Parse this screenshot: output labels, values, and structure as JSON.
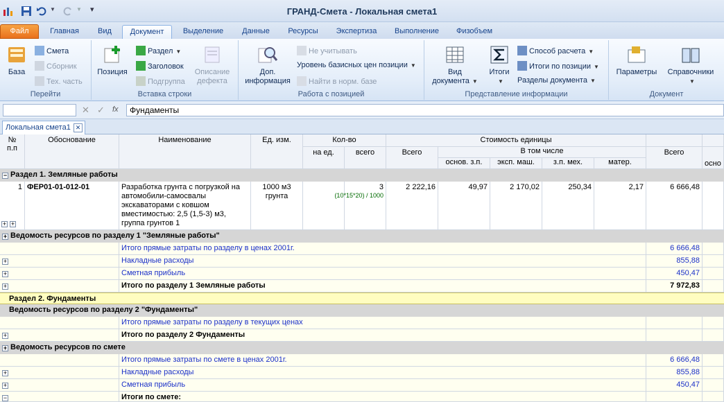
{
  "window": {
    "title": "ГРАНД-Смета - Локальная смета1"
  },
  "tabs": [
    "Файл",
    "Главная",
    "Вид",
    "Документ",
    "Выделение",
    "Данные",
    "Ресурсы",
    "Экспертиза",
    "Выполнение",
    "Физобъем"
  ],
  "ribbon": {
    "goto": {
      "label": "Перейти",
      "base": "База",
      "smeta": "Смета",
      "sbornik": "Сборник",
      "tech": "Тех. часть"
    },
    "insert": {
      "label": "Вставка строки",
      "position": "Позиция",
      "razdel": "Раздел",
      "zagolovok": "Заголовок",
      "podgruppa": "Подгруппа",
      "opisanie1": "Описание",
      "opisanie2": "дефекта"
    },
    "work": {
      "label": "Работа с позицией",
      "dop1": "Доп.",
      "dop2": "информация",
      "ne_uchit": "Не учитывать",
      "uroven": "Уровень базисных цен позиции",
      "najti": "Найти в норм. базе"
    },
    "present": {
      "label": "Представление информации",
      "vid1": "Вид",
      "vid2": "документа",
      "itogi": "Итоги",
      "sposob": "Способ расчета",
      "itogi_poz": "Итоги по позиции",
      "razdely": "Разделы документа"
    },
    "doc": {
      "label": "Документ",
      "params": "Параметры",
      "sprav": "Справочники"
    }
  },
  "formula": {
    "value": "Фундаменты"
  },
  "doc_tab": "Локальная смета1",
  "header": {
    "num": "№ п.п",
    "obosn": "Обоснование",
    "name": "Наименование",
    "unit": "Ед. изм.",
    "qty": "Кол-во",
    "qty_per": "на ед.",
    "qty_total": "всего",
    "unit_cost": "Стоимость единицы",
    "uc_total": "Всего",
    "incl": "В том числе",
    "osn": "основ. з.п.",
    "eksp": "эксп. маш.",
    "zpmeh": "з.п. мех.",
    "mater": "матер.",
    "total": "Всего",
    "osno": "осно"
  },
  "rows": {
    "sec1": "Раздел 1. Земляные работы",
    "pos": {
      "num": "1",
      "code": "ФЕР01-01-012-01",
      "name": "Разработка грунта с погрузкой на автомобили-самосвалы экскаваторами с ковшом вместимостью: 2,5 (1,5-3) м3, группа грунтов 1",
      "unit": "1000 м3 грунта",
      "qty_total": "3",
      "formula": "(10*15*20) / 1000",
      "uc_total": "2 222,16",
      "osn": "49,97",
      "eksp": "2 170,02",
      "zpmeh": "250,34",
      "mater": "2,17",
      "total": "6 666,48"
    },
    "ved1": "Ведомость ресурсов по разделу 1 \"Земляные работы\"",
    "s1_direct": {
      "label": "Итого прямые затраты по разделу в ценах 2001г.",
      "value": "6 666,48"
    },
    "s1_nakl": {
      "label": "Накладные расходы",
      "value": "855,88"
    },
    "s1_prib": {
      "label": "Сметная прибыль",
      "value": "450,47"
    },
    "s1_total": {
      "label": "Итого по разделу 1 Земляные работы",
      "value": "7 972,83"
    },
    "sec2": "Раздел 2. Фундаменты",
    "ved2": "Ведомость ресурсов по разделу 2 \"Фундаменты\"",
    "s2_direct": {
      "label": "Итого прямые затраты по разделу в текущих ценах"
    },
    "s2_total": {
      "label": "Итого по разделу 2 Фундаменты"
    },
    "ved_all": "Ведомость ресурсов по смете",
    "a_direct": {
      "label": "Итого прямые затраты по смете в ценах 2001г.",
      "value": "6 666,48"
    },
    "a_nakl": {
      "label": "Накладные расходы",
      "value": "855,88"
    },
    "a_prib": {
      "label": "Сметная прибыль",
      "value": "450,47"
    },
    "a_total": {
      "label": "Итоги по смете:"
    }
  }
}
